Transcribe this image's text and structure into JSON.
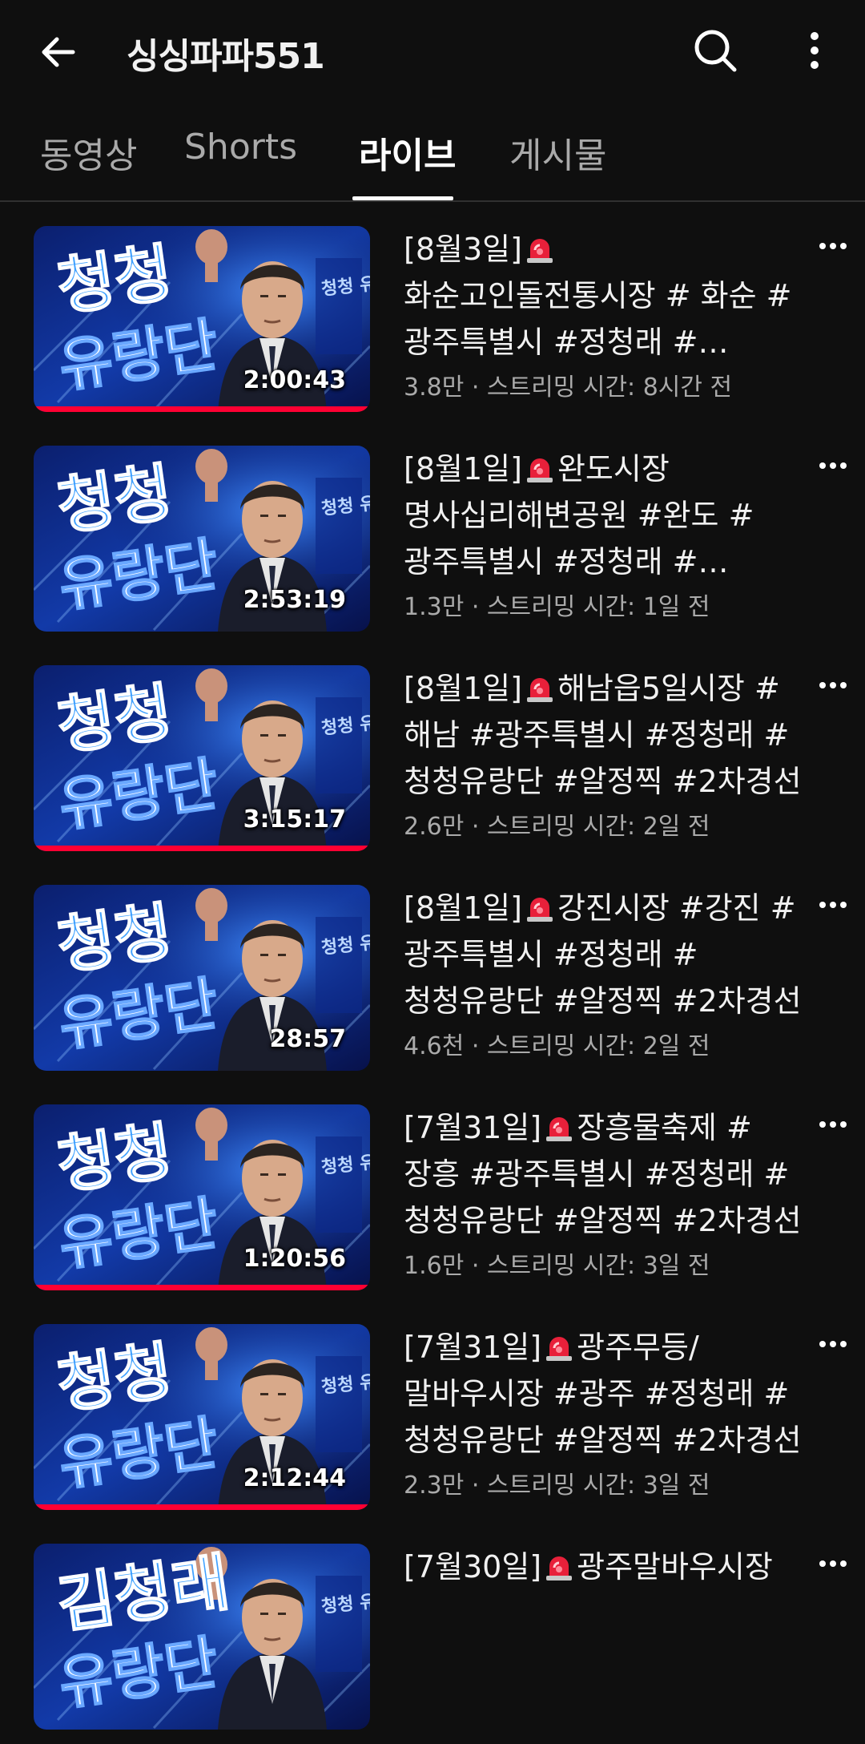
{
  "header": {
    "channel_name": "싱싱파파551"
  },
  "tabs": [
    {
      "label": "동영상",
      "active": false
    },
    {
      "label": "Shorts",
      "active": false
    },
    {
      "label": "라이브",
      "active": true
    },
    {
      "label": "게시물",
      "active": false
    }
  ],
  "thumbnail": {
    "text_line1": "청청",
    "text_line2": "유랑단",
    "side_text": "청청 유랑단",
    "next_text_line1": "김청래"
  },
  "colors": {
    "background": "#0f0f0f",
    "progress": "#ff0033",
    "thumb_blue": "#1e6fff"
  },
  "videos": [
    {
      "title_before": "[8월3일]",
      "title_after": "화순고인돌전통시장 # 화순 #광주특별시 #정청래 #청청유랑단 #알정찍",
      "duration": "2:00:43",
      "meta": "3.8만 · 스트리밍 시간: 8시간 전",
      "watched_fraction": 1.0
    },
    {
      "title_before": "[8월1일]",
      "title_after": "완도시장 명사십리해변공원 #완도 #광주특별시 #정청래 #청청유랑단",
      "duration": "2:53:19",
      "meta": "1.3만 · 스트리밍 시간: 1일 전",
      "watched_fraction": 0.0
    },
    {
      "title_before": "[8월1일]",
      "title_after": "해남읍5일시장 #해남 #광주특별시 #정청래 #청청유랑단 #알정찍 #2차경선",
      "duration": "3:15:17",
      "meta": "2.6만 · 스트리밍 시간: 2일 전",
      "watched_fraction": 1.0
    },
    {
      "title_before": "[8월1일]",
      "title_after": "강진시장 #강진 #광주특별시 #정청래 #청청유랑단 #알정찍 #2차경선",
      "duration": "28:57",
      "meta": "4.6천 · 스트리밍 시간: 2일 전",
      "watched_fraction": 0.0
    },
    {
      "title_before": "[7월31일]",
      "title_after": "장흥물축제 #장흥 #광주특별시 #정청래 #청청유랑단 #알정찍 #2차경선",
      "duration": "1:20:56",
      "meta": "1.6만 · 스트리밍 시간: 3일 전",
      "watched_fraction": 1.0
    },
    {
      "title_before": "[7월31일]",
      "title_after": "광주무등/말바우시장 #광주 #정청래 #청청유랑단 #알정찍 #2차경선",
      "duration": "2:12:44",
      "meta": "2.3만 · 스트리밍 시간: 3일 전",
      "watched_fraction": 1.0
    },
    {
      "title_before": "[7월30일]",
      "title_after": "광주말바우시장",
      "duration": "",
      "meta": "",
      "watched_fraction": 0.0
    }
  ]
}
